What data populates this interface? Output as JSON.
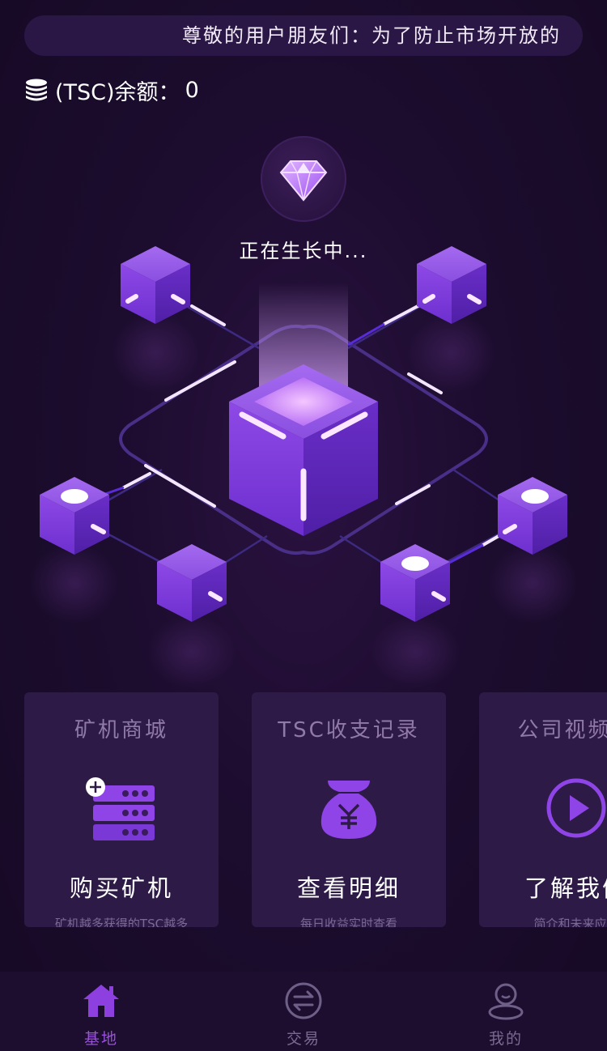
{
  "notice": {
    "text": "尊敬的用户朋友们：为了防止市场开放的"
  },
  "balance": {
    "label": "(TSC)余额：",
    "value": "0"
  },
  "status": {
    "text": "正在生长中..."
  },
  "cards": [
    {
      "title": "矿机商城",
      "action": "购买矿机",
      "desc": "矿机越多获得的TSC越多",
      "icon": "server-add-icon"
    },
    {
      "title": "TSC收支记录",
      "action": "查看明细",
      "desc": "每日收益实时查看",
      "icon": "money-bag-icon"
    },
    {
      "title": "公司视频短",
      "action": "了解我们",
      "desc": "简介和未来应用",
      "icon": "play-circle-icon"
    }
  ],
  "tabs": [
    {
      "label": "基地",
      "icon": "home-icon",
      "active": true
    },
    {
      "label": "交易",
      "icon": "exchange-icon",
      "active": false
    },
    {
      "label": "我的",
      "icon": "user-icon",
      "active": false
    }
  ],
  "colors": {
    "background": "#1c0c2e",
    "accent": "#9b4ee0",
    "card": "#2e1a47",
    "cube": "#7a35d6"
  }
}
